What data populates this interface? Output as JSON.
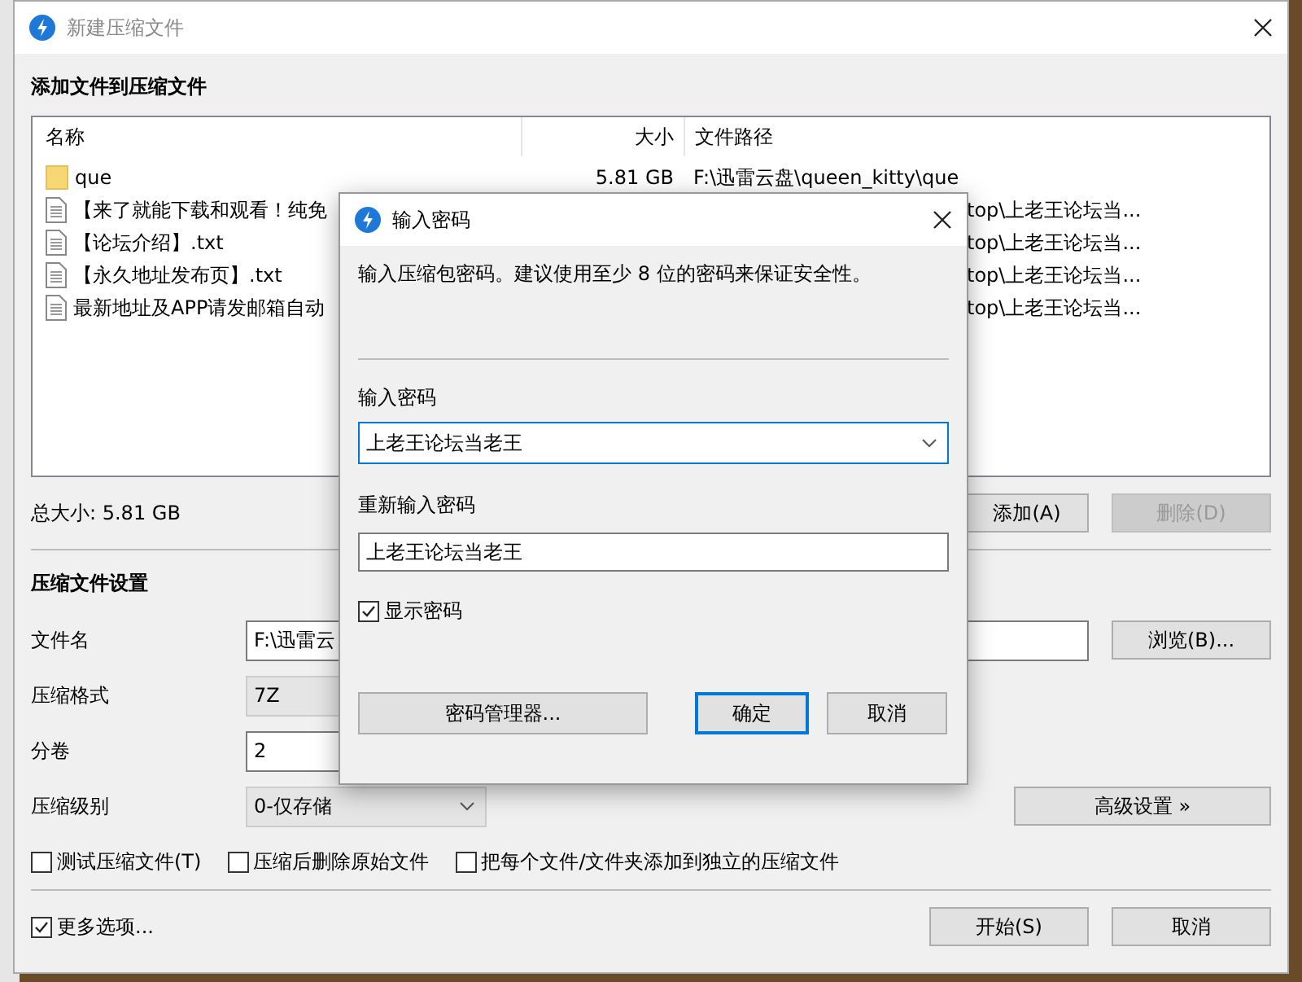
{
  "window": {
    "title": "新建压缩文件"
  },
  "files": {
    "heading": "添加文件到压缩文件",
    "columns": [
      "名称",
      "大小",
      "文件路径"
    ],
    "rows": [
      {
        "kind": "folder",
        "name": "que",
        "size": "5.81 GB",
        "path": "F:\\迅雷云盘\\queen_kitty\\que"
      },
      {
        "kind": "file",
        "name": "【来了就能下载和观看！纯免",
        "path": "top\\上老王论坛当..."
      },
      {
        "kind": "file",
        "name": "【论坛介绍】.txt",
        "path": "top\\上老王论坛当..."
      },
      {
        "kind": "file",
        "name": "【永久地址发布页】.txt",
        "path": "top\\上老王论坛当..."
      },
      {
        "kind": "file",
        "name": "最新地址及APP请发邮箱自动",
        "path": "top\\上老王论坛当..."
      }
    ]
  },
  "total_size": "总大小: 5.81 GB",
  "list_buttons": [
    {
      "label": "添加(A)",
      "disabled": false
    },
    {
      "label": "删除(D)",
      "disabled": true
    }
  ],
  "settings": {
    "heading": "压缩文件设置",
    "fields": [
      {
        "kind": "text",
        "label": "文件名",
        "value": "F:\\迅雷云"
      },
      {
        "kind": "select",
        "label": "压缩格式",
        "value": "7Z"
      },
      {
        "kind": "text",
        "label": "分卷",
        "value": "2"
      },
      {
        "kind": "select",
        "label": "压缩级别",
        "value": "0-仅存储"
      }
    ],
    "browse": "浏览(B)...",
    "advanced": "高级设置 »"
  },
  "options": [
    {
      "label": "测试压缩文件(T)",
      "checked": false
    },
    {
      "label": "压缩后删除原始文件",
      "checked": false
    },
    {
      "label": "把每个文件/文件夹添加到独立的压缩文件",
      "checked": false
    }
  ],
  "more_options": {
    "label": "更多选项...",
    "checked": true
  },
  "footer_buttons": [
    "开始(S)",
    "取消"
  ],
  "dialog": {
    "title": "输入密码",
    "message": "输入压缩包密码。建议使用至少 8 位的密码来保证安全性。",
    "password_label": "输入密码",
    "password": "上老王论坛当老王",
    "confirm_label": "重新输入密码",
    "confirm": "上老王论坛当老王",
    "show_password": {
      "label": "显示密码",
      "checked": true
    },
    "buttons": [
      {
        "label": "密码管理器...",
        "default": false
      },
      {
        "label": "确定",
        "default": true
      },
      {
        "label": "取消",
        "default": false
      }
    ]
  }
}
